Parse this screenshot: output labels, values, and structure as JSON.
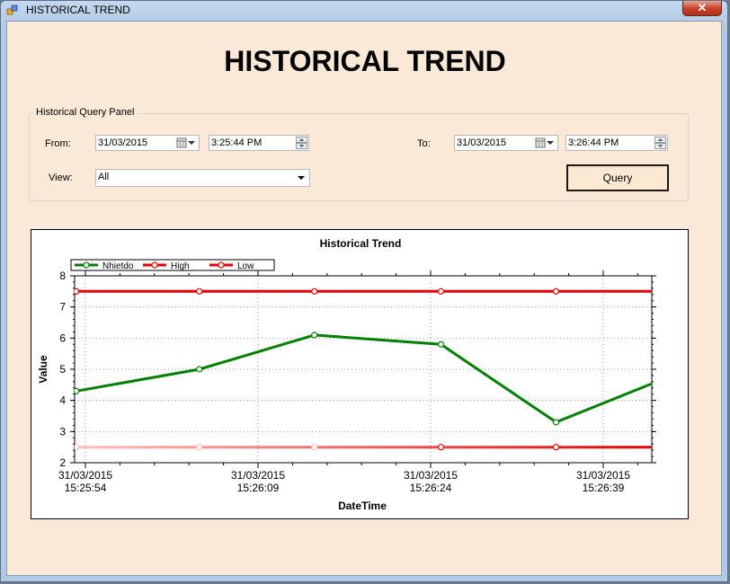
{
  "window": {
    "title": "HISTORICAL TREND",
    "close_label": "✕"
  },
  "page_title": "HISTORICAL TREND",
  "query_panel": {
    "title": "Historical Query Panel",
    "from_label": "From:",
    "from_date": "31/03/2015",
    "from_time": "3:25:44 PM",
    "to_label": "To:",
    "to_date": "31/03/2015",
    "to_time": "3:26:44 PM",
    "view_label": "View:",
    "view_value": "All",
    "query_button": "Query"
  },
  "chart_data": {
    "type": "line",
    "title": "Historical Trend",
    "xlabel": "DateTime",
    "ylabel": "Value",
    "ylim": [
      2,
      8
    ],
    "yticks": [
      2,
      3,
      4,
      5,
      6,
      7,
      8
    ],
    "xlim": [
      0,
      45
    ],
    "xticks": [
      {
        "t": 0,
        "date": "31/03/2015",
        "time": "15:25:54"
      },
      {
        "t": 15,
        "date": "31/03/2015",
        "time": "15:26:09"
      },
      {
        "t": 30,
        "date": "31/03/2015",
        "time": "15:26:24"
      },
      {
        "t": 45,
        "date": "31/03/2015",
        "time": "15:26:39"
      }
    ],
    "grid": true,
    "legend": "top-left",
    "series": [
      {
        "name": "Nhietdo",
        "color": "#008000",
        "points": [
          [
            -0.8,
            4.3
          ],
          [
            9.9,
            5.0
          ],
          [
            19.9,
            6.1
          ],
          [
            30.9,
            5.8
          ],
          [
            40.9,
            3.3
          ],
          [
            51,
            4.8
          ]
        ]
      },
      {
        "name": "High",
        "color": "#e60000",
        "points": [
          [
            -0.8,
            7.5
          ],
          [
            9.9,
            7.5
          ],
          [
            19.9,
            7.5
          ],
          [
            30.9,
            7.5
          ],
          [
            40.9,
            7.5
          ],
          [
            51,
            7.5
          ]
        ]
      },
      {
        "name": "Low",
        "color": "#e60000",
        "fade_color": "#ffc0c0",
        "points": [
          [
            -0.8,
            2.5
          ],
          [
            9.9,
            2.5
          ],
          [
            19.9,
            2.5
          ],
          [
            30.9,
            2.5
          ],
          [
            40.9,
            2.5
          ],
          [
            51,
            2.5
          ]
        ]
      }
    ]
  }
}
